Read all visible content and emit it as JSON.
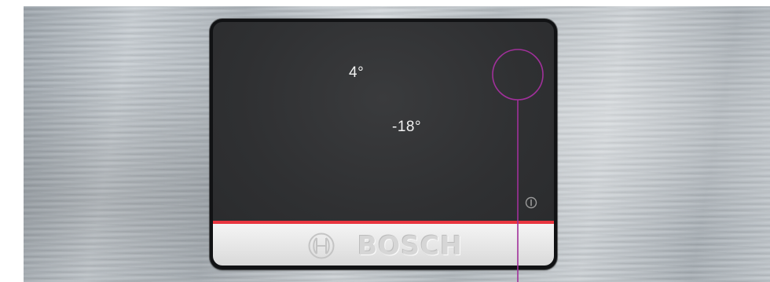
{
  "display": {
    "fridge_temp": "4°",
    "freezer_temp": "-18°"
  },
  "brand": {
    "name": "BOSCH"
  },
  "icons": {
    "power": "power-icon",
    "logo": "bosch-armature-logo-icon"
  },
  "colors": {
    "accent_line": "#e8353f",
    "callout": "#a0309a",
    "screen": "#2f3032"
  }
}
